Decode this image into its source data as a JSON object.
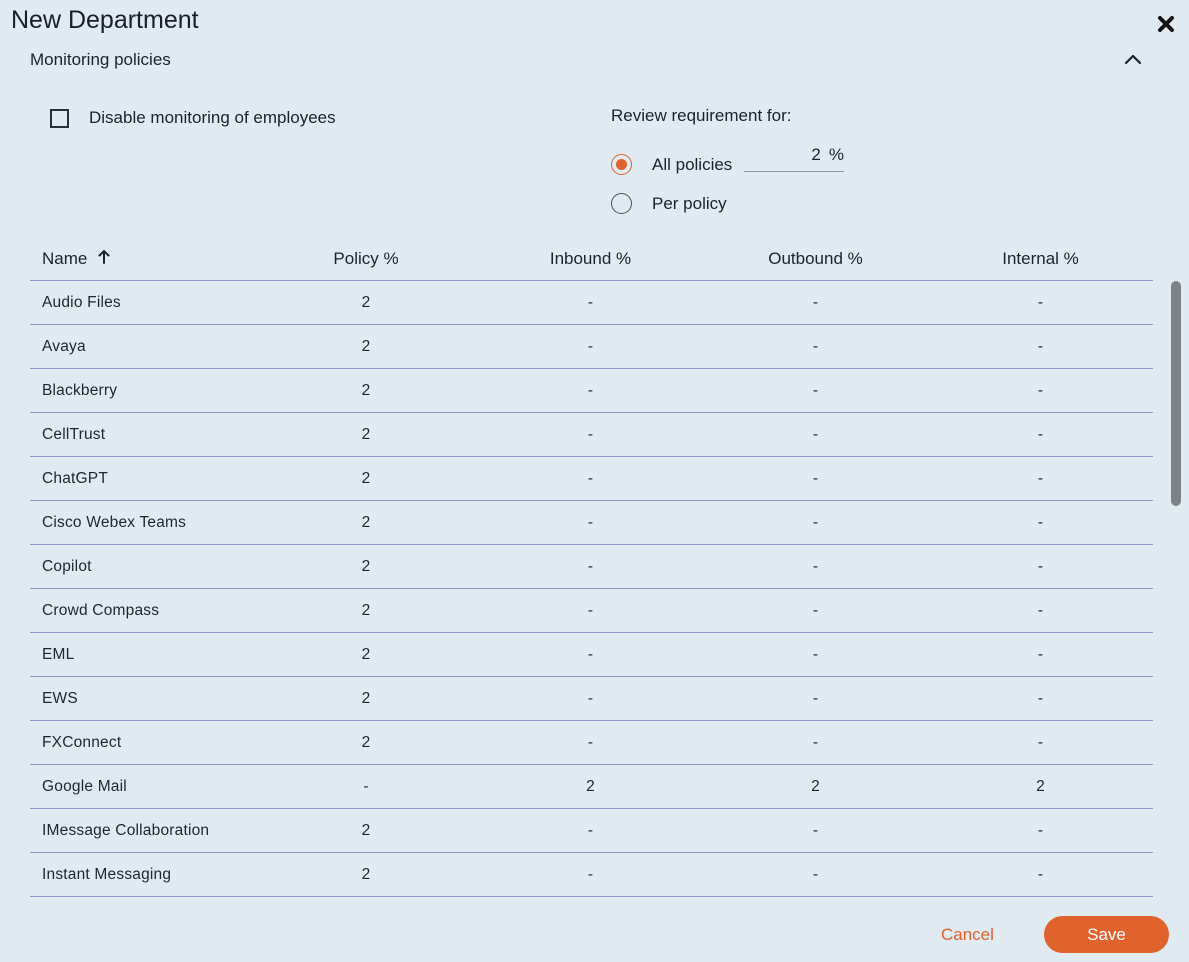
{
  "dialog": {
    "title": "New Department",
    "close_icon": "close-icon"
  },
  "section": {
    "title": "Monitoring policies",
    "collapse_icon": "chevron-up-icon"
  },
  "options": {
    "disable_monitoring_label": "Disable monitoring of employees",
    "disable_monitoring_checked": false,
    "review_label": "Review requirement for:",
    "radios": [
      {
        "label": "All policies",
        "checked": true
      },
      {
        "label": "Per policy",
        "checked": false
      }
    ],
    "all_policies_value": "2",
    "percent_unit": "%"
  },
  "table": {
    "columns": [
      "Name",
      "Policy %",
      "Inbound %",
      "Outbound %",
      "Internal %"
    ],
    "sort_icon": "arrow-up-icon",
    "rows": [
      [
        "Audio Files",
        "2",
        "-",
        "-",
        "-"
      ],
      [
        "Avaya",
        "2",
        "-",
        "-",
        "-"
      ],
      [
        "Blackberry",
        "2",
        "-",
        "-",
        "-"
      ],
      [
        "CellTrust",
        "2",
        "-",
        "-",
        "-"
      ],
      [
        "ChatGPT",
        "2",
        "-",
        "-",
        "-"
      ],
      [
        "Cisco Webex Teams",
        "2",
        "-",
        "-",
        "-"
      ],
      [
        "Copilot",
        "2",
        "-",
        "-",
        "-"
      ],
      [
        "Crowd Compass",
        "2",
        "-",
        "-",
        "-"
      ],
      [
        "EML",
        "2",
        "-",
        "-",
        "-"
      ],
      [
        "EWS",
        "2",
        "-",
        "-",
        "-"
      ],
      [
        "FXConnect",
        "2",
        "-",
        "-",
        "-"
      ],
      [
        "Google Mail",
        "-",
        "2",
        "2",
        "2"
      ],
      [
        "IMessage Collaboration",
        "2",
        "-",
        "-",
        "-"
      ],
      [
        "Instant Messaging",
        "2",
        "-",
        "-",
        "-"
      ]
    ]
  },
  "footer": {
    "cancel_label": "Cancel",
    "save_label": "Save"
  },
  "colors": {
    "accent": "#e0622c",
    "background": "#dfeaf1",
    "row_divider": "#8e9ccc"
  }
}
